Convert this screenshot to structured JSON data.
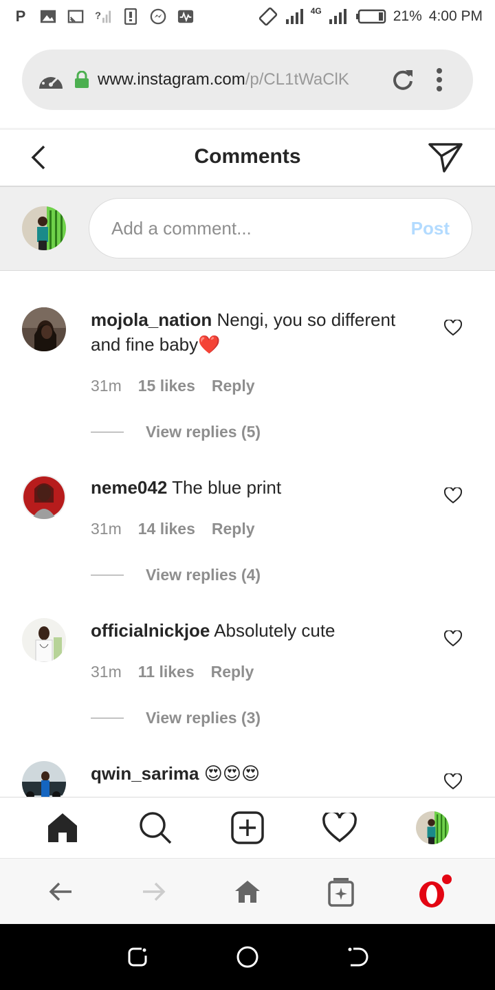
{
  "status_bar": {
    "network_label": "4G",
    "battery": "21%",
    "time": "4:00 PM"
  },
  "browser": {
    "url_main": "www.instagram.com",
    "url_path": "/p/CL1tWaClK"
  },
  "header": {
    "title": "Comments"
  },
  "add_comment": {
    "placeholder": "Add a comment...",
    "post_label": "Post"
  },
  "comments": [
    {
      "username": "mojola_nation",
      "text": "Nengi, you so different and fine baby",
      "emoji": "❤️",
      "time": "31m",
      "likes": "15 likes",
      "reply_label": "Reply",
      "view_replies": "View replies (5)"
    },
    {
      "username": "neme042",
      "text": "The blue print",
      "emoji": "",
      "time": "31m",
      "likes": "14 likes",
      "reply_label": "Reply",
      "view_replies": "View replies (4)"
    },
    {
      "username": "officialnickjoe",
      "text": "Absolutely cute",
      "emoji": "",
      "time": "31m",
      "likes": "11 likes",
      "reply_label": "Reply",
      "view_replies": "View replies (3)"
    },
    {
      "username": "qwin_sarima",
      "text": "",
      "emoji": "😍😍😍"
    }
  ],
  "icons": {
    "status_left": [
      "p-icon",
      "image-icon",
      "cast-icon",
      "no-signal-icon",
      "sim-icon",
      "messenger-icon",
      "activity-icon"
    ],
    "browser": [
      "speedometer-icon",
      "lock-icon",
      "reload-icon",
      "more-vertical-icon"
    ],
    "tabs": [
      "home-icon",
      "search-icon",
      "new-post-icon",
      "activity-heart-icon",
      "profile-avatar"
    ],
    "opera": [
      "back-arrow-icon",
      "forward-arrow-icon",
      "home-icon",
      "tabs-icon",
      "opera-logo-icon"
    ]
  },
  "colors": {
    "post_disabled": "#b3dbff",
    "secure_green": "#4caf50",
    "opera_red": "#e30613",
    "muted_text": "#8e8e8e"
  }
}
